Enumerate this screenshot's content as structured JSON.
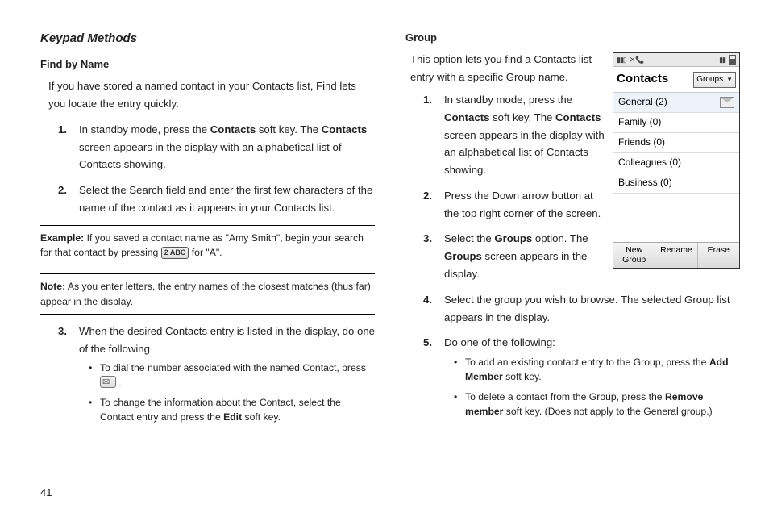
{
  "page_number": "41",
  "left": {
    "heading": "Keypad Methods",
    "subheading": "Find by Name",
    "intro": "If you have stored a named contact in your Contacts list, Find lets you locate the entry quickly.",
    "step1_a": "In standby mode, press the ",
    "step1_b": "Contacts",
    "step1_c": " soft key. The ",
    "step1_d": "Contacts",
    "step1_e": " screen appears in the display with an alphabetical list of Contacts showing.",
    "step2": "Select the Search field and enter the first few characters of the name of the contact as it appears in your Contacts list.",
    "example_lead": "Example:",
    "example_body_a": " If you saved a contact name as \"Amy Smith\", begin your search for that contact by pressing ",
    "example_key": "2 ABC",
    "example_body_b": " for \"A\".",
    "note_lead": "Note:",
    "note_body": " As you enter letters, the entry names of the closest matches (thus far) appear in the display.",
    "step3": "When the desired Contacts entry is listed in the display, do one of the following",
    "bullet1_a": "To dial the number associated with the named Contact, press ",
    "bullet1_b": " .",
    "bullet2_a": "To change the information about the Contact, select the Contact entry and press the ",
    "bullet2_b": "Edit",
    "bullet2_c": " soft key."
  },
  "right": {
    "subheading": "Group",
    "intro": "This option lets you find a Contacts list entry with a specific Group name.",
    "step1_a": "In standby mode, press the ",
    "step1_b": "Contacts",
    "step1_c": " soft key. The ",
    "step1_d": "Contacts",
    "step1_e": " screen appears in the display with an alphabetical list of Contacts showing.",
    "step2": "Press the Down arrow button at the top right corner of the screen.",
    "step3_a": "Select the ",
    "step3_b": "Groups",
    "step3_c": " option. The ",
    "step3_d": "Groups",
    "step3_e": " screen appears in the display.",
    "step4": "Select the group you wish to browse. The selected Group list appears in the display.",
    "step5": "Do one of the following:",
    "bullet1_a": "To add an existing contact entry to the Group, press the ",
    "bullet1_b": "Add Member",
    "bullet1_c": " soft key.",
    "bullet2_a": "To delete a contact from the Group, press the ",
    "bullet2_b": "Remove member",
    "bullet2_c": " soft key. (Does not apply to the General group.)"
  },
  "phone": {
    "title": "Contacts",
    "dropdown": "Groups",
    "rows": [
      "General (2)",
      "Family (0)",
      "Friends (0)",
      "Colleagues (0)",
      "Business (0)"
    ],
    "softkeys": [
      "New\nGroup",
      "Rename",
      "Erase"
    ]
  }
}
